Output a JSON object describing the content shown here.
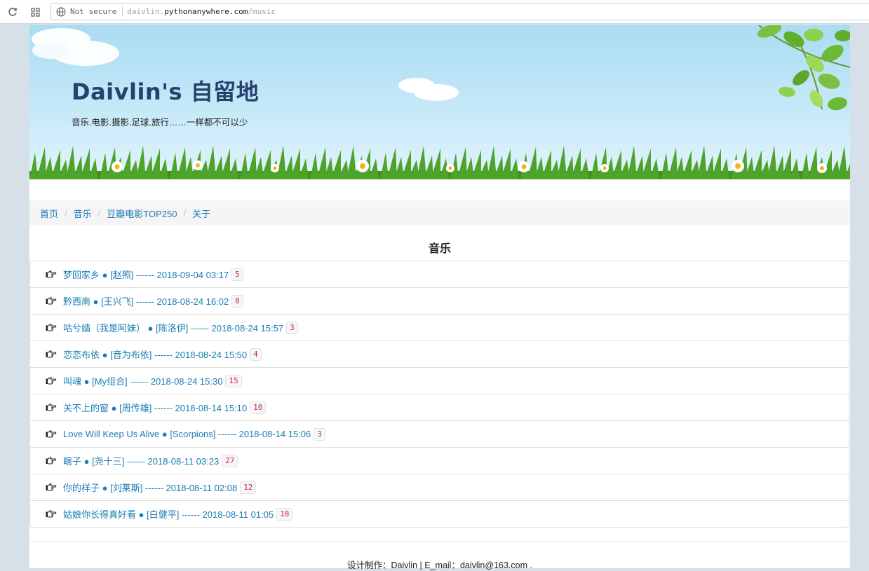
{
  "browser": {
    "security_label": "Not secure",
    "url_prefix": "daivlin.",
    "url_host": "pythonanywhere.com",
    "url_path": "/music"
  },
  "header": {
    "title": "Daivlin's 自留地",
    "subtitle": "音乐.电影.摄影.足球.旅行……一样都不可以少"
  },
  "breadcrumb": [
    "首页",
    "音乐",
    "豆瓣电影TOP250",
    "关于"
  ],
  "section_title": "音乐",
  "songs": [
    {
      "text": "梦回家乡 ● [赵照] ------ 2018-09-04 03:17",
      "count": "5"
    },
    {
      "text": "黔西南 ● [王兴飞] ------ 2018-08-24 16:02",
      "count": "8"
    },
    {
      "text": "咕兮嫱（我是阿妹） ● [陈洛伊] ------ 2018-08-24 15:57",
      "count": "3"
    },
    {
      "text": "恋恋布依 ● [音为布依] ------ 2018-08-24 15:50",
      "count": "4"
    },
    {
      "text": "叫魂 ● [My组合] ------ 2018-08-24 15:30",
      "count": "15"
    },
    {
      "text": "关不上的窗 ● [周传雄] ------ 2018-08-14 15:10",
      "count": "10"
    },
    {
      "text": "Love Will Keep Us Alive ● [Scorpions] ------ 2018-08-14 15:06",
      "count": "3"
    },
    {
      "text": "瞎子 ● [尧十三] ------ 2018-08-11 03:23",
      "count": "27"
    },
    {
      "text": "你的样子 ● [刘莱斯] ------ 2018-08-11 02:08",
      "count": "12"
    },
    {
      "text": "姑娘你长得真好看 ● [白健平] ------ 2018-08-11 01:05",
      "count": "18"
    }
  ],
  "footer": "设计制作：Daivlin | E_mail：daivlin@163.com .",
  "colors": {
    "link": "#1a7cb5",
    "title": "#26416d",
    "badge_text": "#c7254e"
  },
  "icons": {
    "list_bullet": "hand-point-right-icon"
  }
}
